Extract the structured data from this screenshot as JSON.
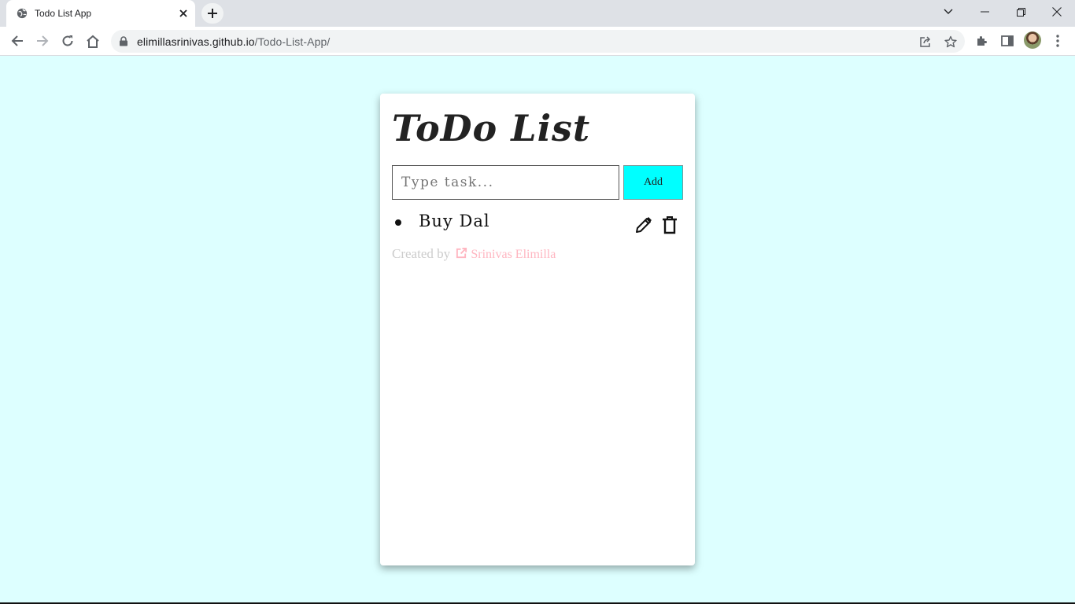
{
  "browser": {
    "tab_title": "Todo List App",
    "url_host": "elimillasrinivas.github.io",
    "url_path": "/Todo-List-App/"
  },
  "app": {
    "title": "ToDo List",
    "input_placeholder": "Type task...",
    "input_value": "",
    "add_label": "Add",
    "tasks": [
      {
        "label": "Buy Dal"
      }
    ],
    "footer_prefix": "Created by",
    "author_name": "Srinivas Elimilla"
  },
  "colors": {
    "page_background": "#ddffff",
    "add_button": "#00ffff",
    "author_link": "#ffb6c1",
    "footer_text": "#cccccc"
  },
  "icons": [
    "globe-icon",
    "close-icon",
    "plus-icon",
    "back-icon",
    "forward-icon",
    "reload-icon",
    "home-icon",
    "lock-icon",
    "share-icon",
    "star-icon",
    "extensions-icon",
    "side-panel-icon",
    "kebab-menu-icon",
    "pencil-icon",
    "trash-icon",
    "external-link-icon"
  ]
}
